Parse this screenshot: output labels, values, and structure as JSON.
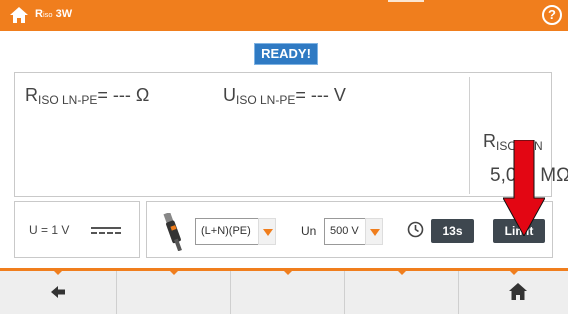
{
  "header": {
    "title_main": "R",
    "title_sub": "iso",
    "title_suffix": " 3W",
    "home_icon": "home-icon",
    "help_label": "?",
    "colors": {
      "bar": "#f07e1d",
      "text": "#ffffff"
    }
  },
  "status": {
    "label": "READY!",
    "color": "#2f7ac3"
  },
  "result": {
    "riso": {
      "symbol": "R",
      "sub": "ISO LN-PE",
      "value": "= --- Ω"
    },
    "uiso": {
      "symbol": "U",
      "sub": "ISO LN-PE",
      "value": "= --- V"
    },
    "limit": {
      "symbol": "R",
      "sub": "ISO",
      "sub_tail": "IN",
      "value": "5,00",
      "unit": "MΩ"
    }
  },
  "voltage_box": {
    "label": "U = 1 V",
    "icon": "dc-voltage-icon"
  },
  "settings": {
    "probe_icon": "probe-icon",
    "circuit": "(L+N)(PE)",
    "un_label": "Un",
    "un_value": "500 V",
    "clock_icon": "clock-icon",
    "time": "13s",
    "limit_label": "Limit"
  },
  "nav": {
    "back_icon": "arrow-left-icon",
    "home_icon": "home-icon",
    "accent": "#f07e1d"
  },
  "annotation": {
    "arrow_color": "#e30613",
    "icon": "red-arrow-icon"
  }
}
